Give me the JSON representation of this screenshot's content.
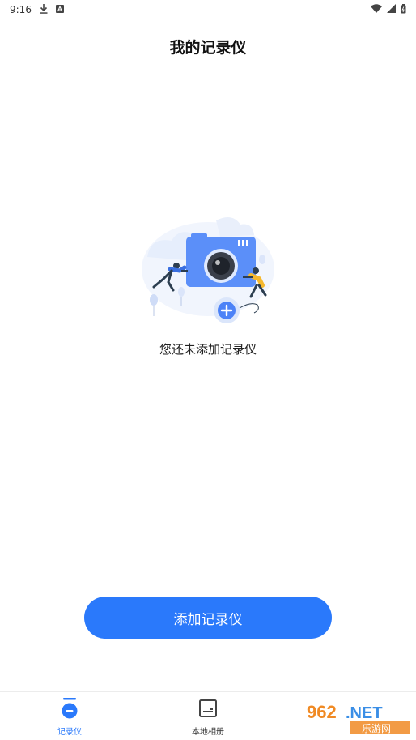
{
  "status_bar": {
    "time": "9:16",
    "icons": [
      "download-icon",
      "notification-a-icon",
      "wifi-icon",
      "signal-icon",
      "battery-icon"
    ]
  },
  "header": {
    "title": "我的记录仪"
  },
  "empty_state": {
    "illustration": "camera-with-people-illustration",
    "message": "您还未添加记录仪"
  },
  "actions": {
    "add_label": "添加记录仪"
  },
  "bottom_nav": {
    "items": [
      {
        "label": "记录仪",
        "icon": "recorder-icon",
        "active": true
      },
      {
        "label": "本地相册",
        "icon": "album-icon",
        "active": false
      }
    ]
  },
  "watermark": {
    "text": "962.NET",
    "subtext": "乐游网"
  },
  "colors": {
    "accent": "#2a79fb",
    "illustration_blue": "#5b8ff9",
    "illustration_light": "#e8f0fe",
    "person_yellow": "#f5b82e"
  }
}
